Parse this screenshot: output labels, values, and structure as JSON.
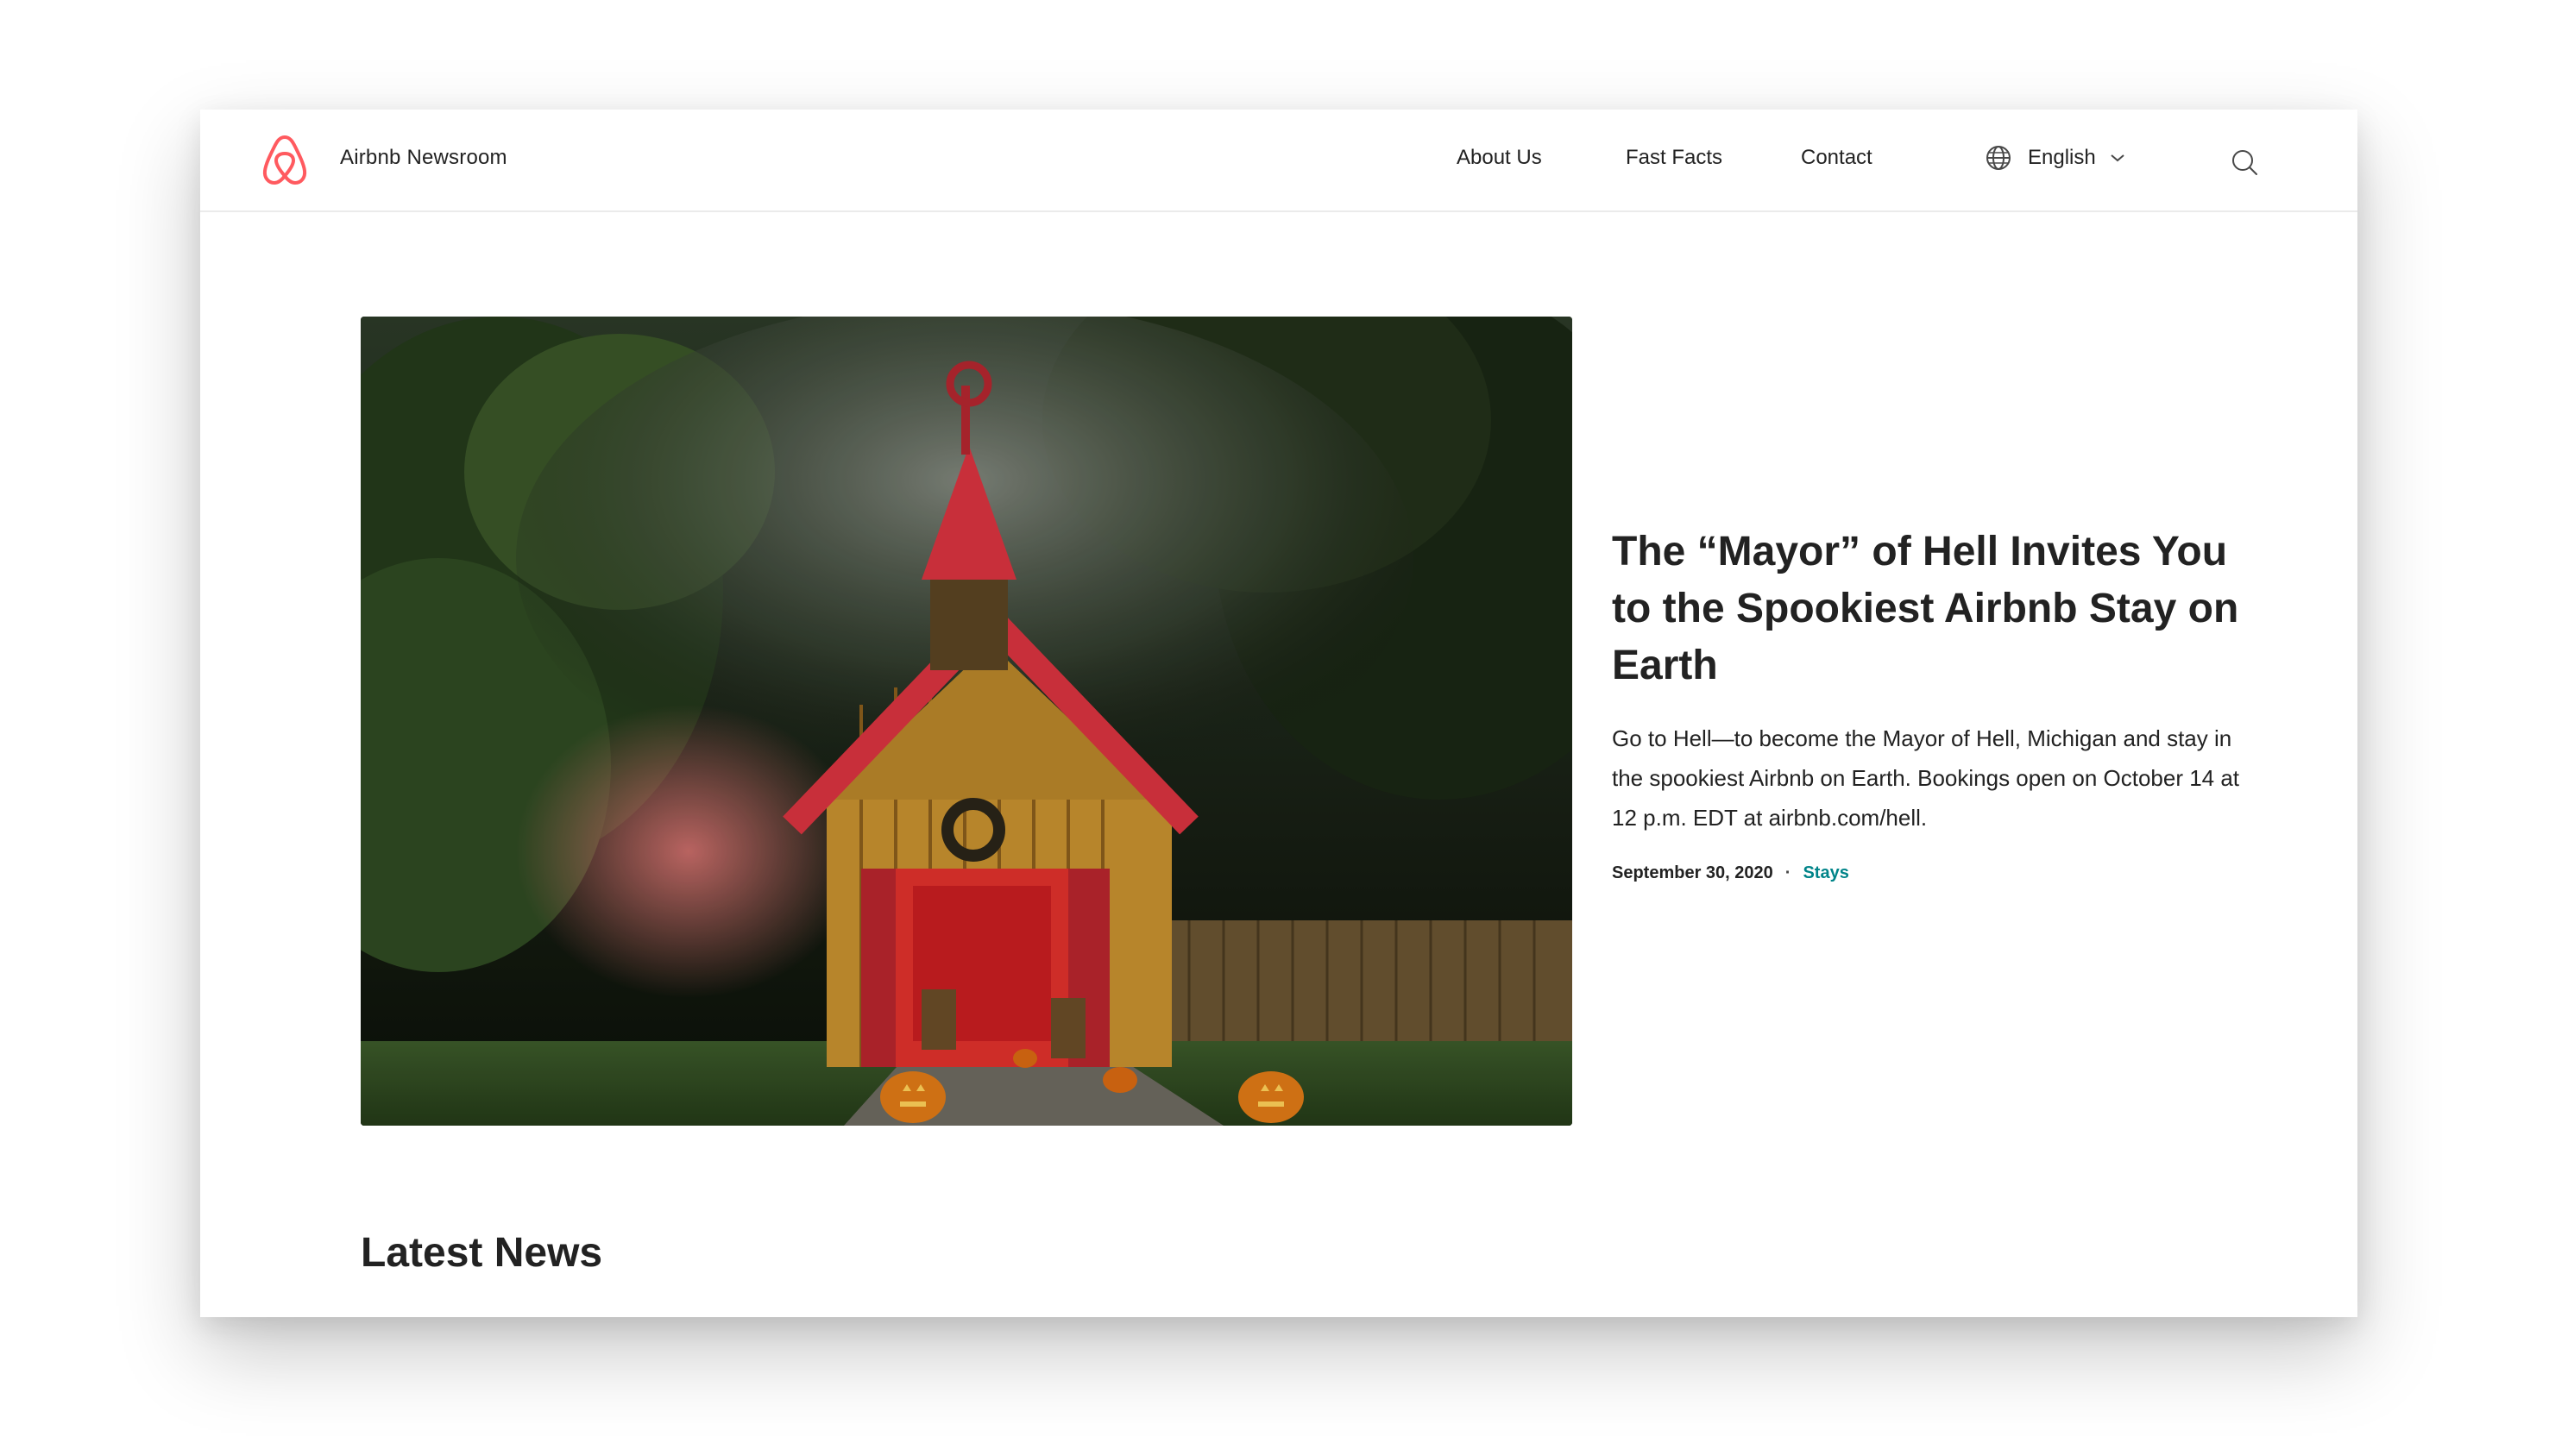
{
  "header": {
    "brand": "Airbnb Newsroom",
    "logo_icon": "airbnb-belo-icon",
    "brand_color": "#FF5A5F",
    "nav": [
      {
        "label": "About Us"
      },
      {
        "label": "Fast Facts"
      },
      {
        "label": "Contact"
      }
    ],
    "language": {
      "label": "English",
      "icon": "globe-icon",
      "chevron": "chevron-down-icon"
    },
    "search_icon": "search-icon"
  },
  "hero": {
    "image_description_icon": "hero-image",
    "title": "The “Mayor” of Hell Invites You to the Spookiest Airbnb Stay on Earth",
    "description": "Go to Hell—to become the Mayor of Hell, Michigan and stay in the spookiest Airbnb on Earth. Bookings open on October 14 at 12 p.m. EDT at airbnb.com/hell.",
    "date": "September 30, 2020",
    "separator": "·",
    "category": "Stays",
    "category_color": "#008489"
  },
  "latest": {
    "heading": "Latest News"
  }
}
